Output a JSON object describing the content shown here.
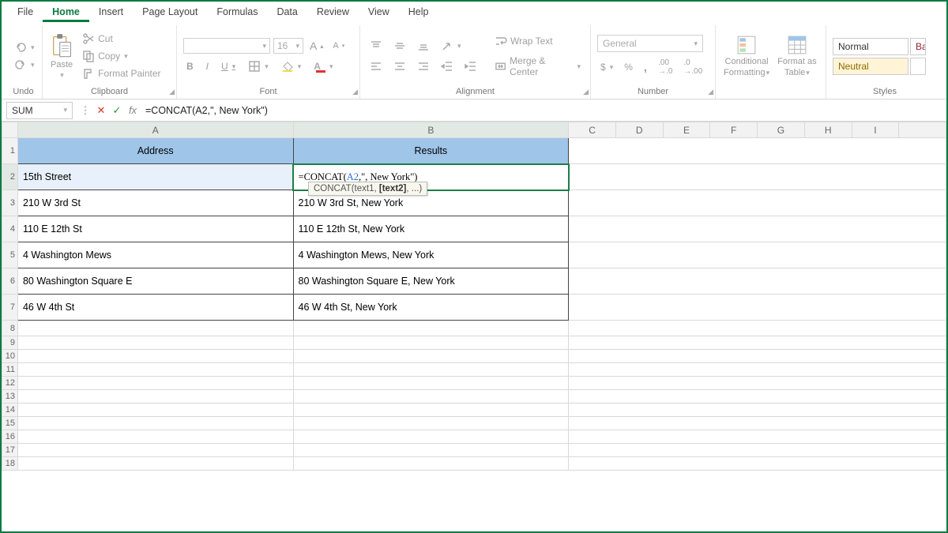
{
  "menu": {
    "file": "File",
    "home": "Home",
    "insert": "Insert",
    "page": "Page Layout",
    "formulas": "Formulas",
    "data": "Data",
    "review": "Review",
    "view": "View",
    "help": "Help"
  },
  "ribbon": {
    "undo": "Undo",
    "paste": "Paste",
    "cut": "Cut",
    "copy": "Copy",
    "fp": "Format Painter",
    "clipboard": "Clipboard",
    "fontname": "",
    "fontsize": "16",
    "fontlabel": "Font",
    "wrap": "Wrap Text",
    "merge": "Merge & Center",
    "align": "Alignment",
    "numfmt": "General",
    "number": "Number",
    "condfmt": "Conditional",
    "condfmt2": "Formatting",
    "fmtas": "Format as",
    "fmtas2": "Table",
    "styles": "Styles",
    "style_normal": "Normal",
    "style_bad": "Ba",
    "style_neutral": "Neutral"
  },
  "namebox": "SUM",
  "formula": {
    "pre": "=CONCAT(",
    "ref": "A2",
    "post": ",\", New York\")",
    "full": "=CONCAT(A2,\", New York\")"
  },
  "tooltip": {
    "fn": "CONCAT(",
    "a1": "text1,",
    "a2": " [text2]",
    "rest": ", ...)"
  },
  "cols": {
    "A": "A",
    "B": "B",
    "C": "C",
    "D": "D",
    "E": "E",
    "F": "F",
    "G": "G",
    "H": "H",
    "I": "I"
  },
  "table": {
    "h1": "Address",
    "h2": "Results",
    "rows": [
      {
        "a": "15th Street",
        "b_formula": true
      },
      {
        "a": "210 W 3rd St",
        "b": "210 W 3rd St, New York"
      },
      {
        "a": "110 E 12th St",
        "b": "110 E 12th St, New York"
      },
      {
        "a": "4 Washington Mews",
        "b": "4 Washington Mews, New York"
      },
      {
        "a": "80 Washington Square E",
        "b": "80 Washington Square E, New York"
      },
      {
        "a": "46 W 4th St",
        "b": "46 W 4th St, New York"
      }
    ]
  }
}
